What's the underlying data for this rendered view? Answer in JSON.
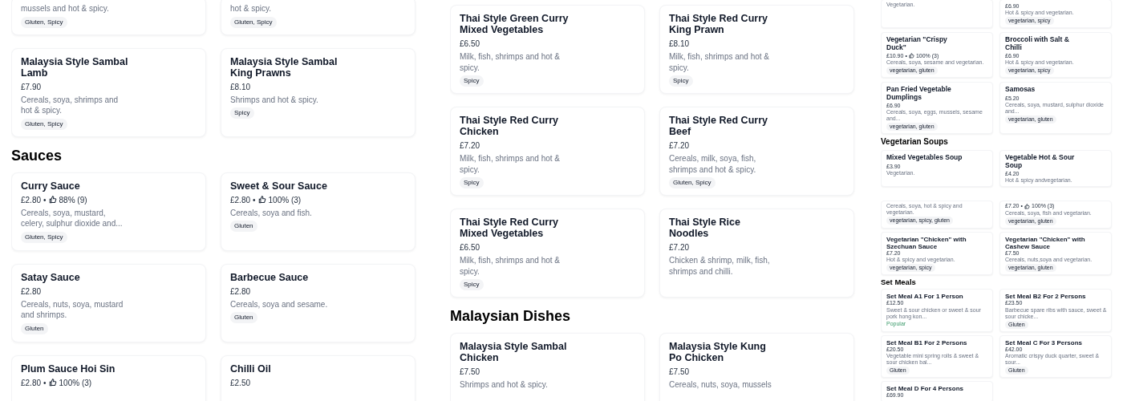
{
  "panels": [
    {
      "kind": "large",
      "sections": [
        {
          "items": [
            {
              "description": "mussels and hot & spicy.",
              "tags": "Gluten, Spicy"
            },
            {
              "description": "hot & spicy.",
              "tags": "Gluten, Spicy"
            },
            {
              "name": "Malaysia Style Sambal Lamb",
              "price": "£7.90",
              "description": "Cereals, soya, shrimps and hot & spicy.",
              "tags": "Gluten, Spicy"
            },
            {
              "name": "Malaysia Style Sambal King Prawns",
              "price": "£8.10",
              "description": "Shrimps and hot & spicy.",
              "tags": "Spicy"
            }
          ]
        },
        {
          "heading": "Sauces",
          "items": [
            {
              "name": "Curry Sauce",
              "price": "£2.80",
              "dot": "•",
              "rating": "88% (9)",
              "description": "Cereals, soya, mustard, celery, sulphur dioxide and...",
              "tags": "Gluten, Spicy"
            },
            {
              "name": "Sweet & Sour Sauce",
              "price": "£2.80",
              "dot": "•",
              "rating": "100% (3)",
              "description": "Cereals, soya and fish.",
              "tags": "Gluten"
            },
            {
              "name": "Satay Sauce",
              "price": "£2.80",
              "description": "Cereals, nuts, soya, mustard and shrimps.",
              "tags": "Gluten"
            },
            {
              "name": "Barbecue Sauce",
              "price": "£2.80",
              "description": "Cereals, soya and sesame.",
              "tags": "Gluten"
            },
            {
              "name": "Plum Sauce Hoi Sin",
              "price": "£2.80",
              "dot": "•",
              "rating": "100% (3)"
            },
            {
              "name": "Chilli Oil",
              "price": "£2.50"
            }
          ]
        }
      ]
    },
    {
      "kind": "large",
      "sections": [
        {
          "items": [
            {
              "name": "Thai Style Green Curry Mixed Vegetables",
              "price": "£6.50",
              "description": "Milk, fish, shrimps and hot & spicy.",
              "tags": "Spicy"
            },
            {
              "name": "Thai Style Red Curry King Prawn",
              "price": "£8.10",
              "description": "Milk, fish, shrimps and hot & spicy.",
              "tags": "Spicy"
            },
            {
              "name": "Thai Style Red Curry Chicken",
              "price": "£7.20",
              "description": "Milk, fish, shrimps and hot & spicy.",
              "tags": "Spicy"
            },
            {
              "name": "Thai Style Red Curry Beef",
              "price": "£7.20",
              "description": "Cereals, milk, soya, fish, shrimps and hot & spicy.",
              "tags": "Gluten, Spicy"
            },
            {
              "name": "Thai Style Red Curry Mixed Vegetables",
              "price": "£6.50",
              "description": "Milk, fish, shrimps and hot & spicy.",
              "tags": "Spicy"
            },
            {
              "name": "Thai Style Rice Noodles",
              "price": "£7.20",
              "description": "Chicken & shrimp, milk, fish, shrimps and chilli."
            }
          ]
        },
        {
          "heading": "Malaysian Dishes",
          "items": [
            {
              "name": "Malaysia Style Sambal Chicken",
              "price": "£7.50",
              "description": "Shrimps and hot & spicy."
            },
            {
              "name": "Malaysia Style Kung Po Chicken",
              "price": "£7.50",
              "description": "Cereals, nuts, soya, mussels"
            }
          ]
        }
      ]
    },
    {
      "kind": "small",
      "sections": [
        {
          "items": [
            {
              "description": "Vegetarian."
            },
            {
              "price": "£6.90",
              "description": "Hot & spicy and vegetarian.",
              "tags": "vegetarian, spicy"
            },
            {
              "name": "Vegetarian \"Crispy Duck\"",
              "price": "£10.90",
              "dot": "•",
              "rating": "100% (3)",
              "description": "Cereals, soya, sesame and vegetarian.",
              "tags": "vegetarian, gluten"
            },
            {
              "name": "Broccoli with Salt & Chilli",
              "price": "£6.90",
              "description": "Hot & spicy and vegetarian.",
              "tags": "vegetarian, spicy"
            },
            {
              "name": "Pan Fried Vegetable Dumplings",
              "price": "£6.90",
              "description": "Cereals, soya, eggs, mussels, sesame and...",
              "tags": "vegetarian, gluten"
            },
            {
              "name": "Samosas",
              "price": "£5.20",
              "description": "Cereals, soya, mustard, sulphur dioxide and...",
              "tags": "vegetarian, gluten"
            }
          ]
        },
        {
          "heading": "Vegetarian Soups",
          "items": [
            {
              "name": "Mixed Vegetables Soup",
              "price": "£3.90",
              "description": "Vegetarian."
            },
            {
              "name": "Vegetable Hot & Sour Soup",
              "price": "£4.20",
              "description": "Hot & spicy andvegetarian."
            }
          ]
        }
      ]
    },
    {
      "kind": "tiny",
      "sections": [
        {
          "items": [
            {
              "description": "Cereals, soya, hot & spicy and vegetarian.",
              "tags": "vegetarian, spicy, gluten"
            },
            {
              "price": "£7.20",
              "dot": "•",
              "rating": "100% (3)",
              "description": "Cereals, soya, fish and vegetarian.",
              "tags": "vegetarian, gluten"
            },
            {
              "name": "Vegetarian \"Chicken\" with Szechuan Sauce",
              "price": "£7.20",
              "description": "Hot & spicy and vegetarian.",
              "tags": "vegetarian, spicy"
            },
            {
              "name": "Vegetarian \"Chicken\" with Cashew Sauce",
              "price": "£7.50",
              "description": "Cereals, nuts,soya and vegetarian.",
              "tags": "vegetarian, gluten"
            }
          ]
        },
        {
          "heading": "Set Meals",
          "items": [
            {
              "name": "Set Meal A1 For 1 Person",
              "price": "£12.50",
              "description": "Sweet & sour chicken or sweet & sour pork hong kon...",
              "badge": "Popular"
            },
            {
              "name": "Set Meal B2 For 2 Persons",
              "price": "£23.50",
              "description": "Barbecue spare ribs with sauce, sweet & sour chicke...",
              "tags": "Gluten"
            },
            {
              "name": "Set Meal B1 For 2 Persons",
              "price": "£20.50",
              "description": "Vegetable mini spring rolls & sweet & sour chicken bal...",
              "tags": "Gluten"
            },
            {
              "name": "Set Meal C For 3 Persons",
              "price": "£42.00",
              "description": "Aromatic crispy duck quarter, sweet & sour...",
              "tags": "Gluten"
            },
            {
              "name": "Set Meal D For 4 Persons",
              "price": "£69.90"
            }
          ]
        }
      ]
    }
  ]
}
